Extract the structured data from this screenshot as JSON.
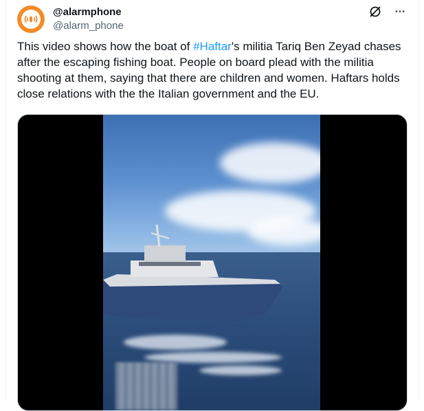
{
  "tweet": {
    "display_name": "@alarmphone",
    "handle": "@alarm_phone",
    "text_before": "This video shows how the boat of ",
    "hashtag": "#Haftar",
    "text_after": "'s militia Tariq Ben Zeyad chases after the escaping fishing boat. People on board plead with the militia shooting at them, saying that there are children and women. Haftars holds close relations with the the Italian government and the EU.",
    "more_label": "···"
  },
  "icons": {
    "avatar": "alarmphone-logo",
    "grok": "grok-icon",
    "more": "more-icon"
  },
  "colors": {
    "avatar_bg": "#f28c28",
    "link": "#1d9bf0",
    "text": "#0f1419",
    "secondary": "#536471"
  }
}
